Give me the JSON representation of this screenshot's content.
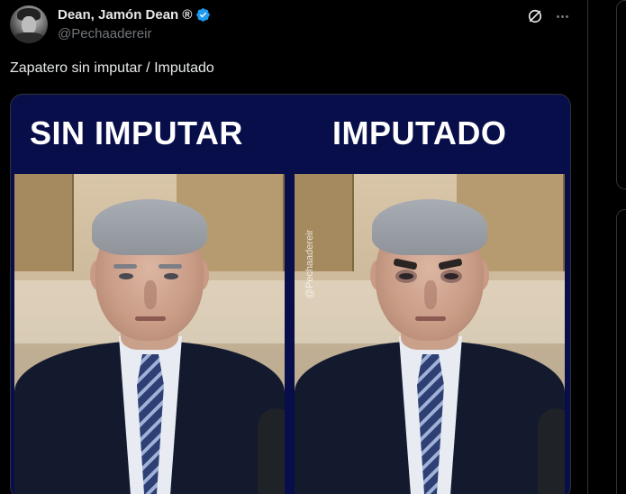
{
  "post": {
    "display_name": "Dean, Jamón Dean ®",
    "handle": "@Pechaadereir",
    "text": "Zapatero sin imputar / Imputado",
    "verified_icon": "verified-badge-icon",
    "accent_color": "#1d9bf0"
  },
  "media": {
    "left_title": "SIN IMPUTAR",
    "right_title": "IMPUTADO",
    "watermark": "@Pechaadereir",
    "banner_color": "#080e4a"
  },
  "actions": {
    "grok_icon": "grok-icon",
    "more_icon": "more-options-icon"
  }
}
